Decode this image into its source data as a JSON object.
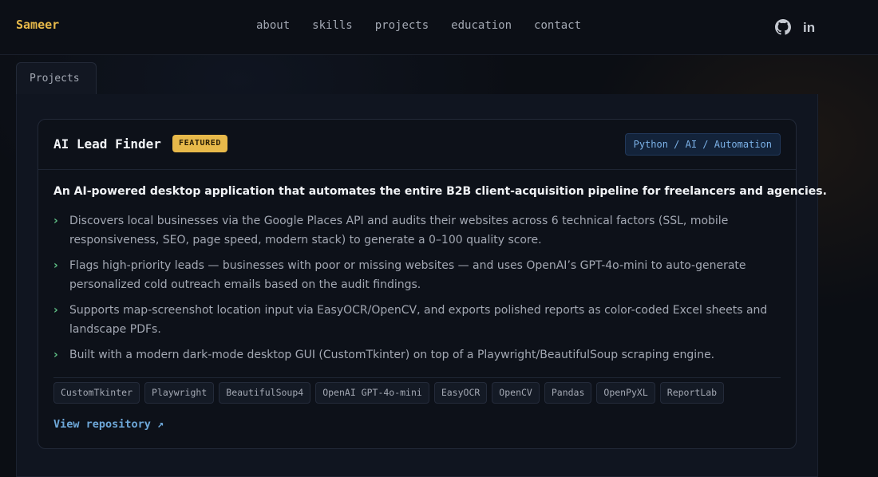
{
  "header": {
    "brand": "Sameer",
    "nav": [
      "about",
      "skills",
      "projects",
      "education",
      "contact"
    ],
    "social": [
      "github-icon",
      "linkedin-icon"
    ],
    "social_label": [
      "in"
    ]
  },
  "section": {
    "tab_label": "Projects"
  },
  "project": {
    "title": "AI Lead Finder",
    "badge": "FEATURED",
    "tech_stack": "Python / AI / Automation",
    "description": "An AI-powered desktop application that automates the entire B2B client-acquisition pipeline for freelancers and agencies.",
    "bullets": [
      "Discovers local businesses via the Google Places API and audits their websites across 6 technical factors (SSL, mobile responsiveness, SEO, page speed, modern stack) to generate a 0–100 quality score.",
      "Flags high-priority leads — businesses with poor or missing websites — and uses OpenAI’s GPT-4o-mini to auto-generate personalized cold outreach emails based on the audit findings.",
      "Supports map-screenshot location input via EasyOCR/OpenCV, and exports polished reports as color-coded Excel sheets and landscape PDFs.",
      "Built with a modern dark-mode desktop GUI (CustomTkinter) on top of a Playwright/BeautifulSoup scraping engine."
    ],
    "tags": [
      "CustomTkinter",
      "Playwright",
      "BeautifulSoup4",
      "OpenAI GPT-4o-mini",
      "EasyOCR",
      "OpenCV",
      "Pandas",
      "OpenPyXL",
      "ReportLab"
    ],
    "link_label": "View repository ↗"
  },
  "colors": {
    "accent": "#e7b94a",
    "link": "#6ea8d9",
    "chevron": "#5fbf85",
    "background": "#0b0e14"
  }
}
